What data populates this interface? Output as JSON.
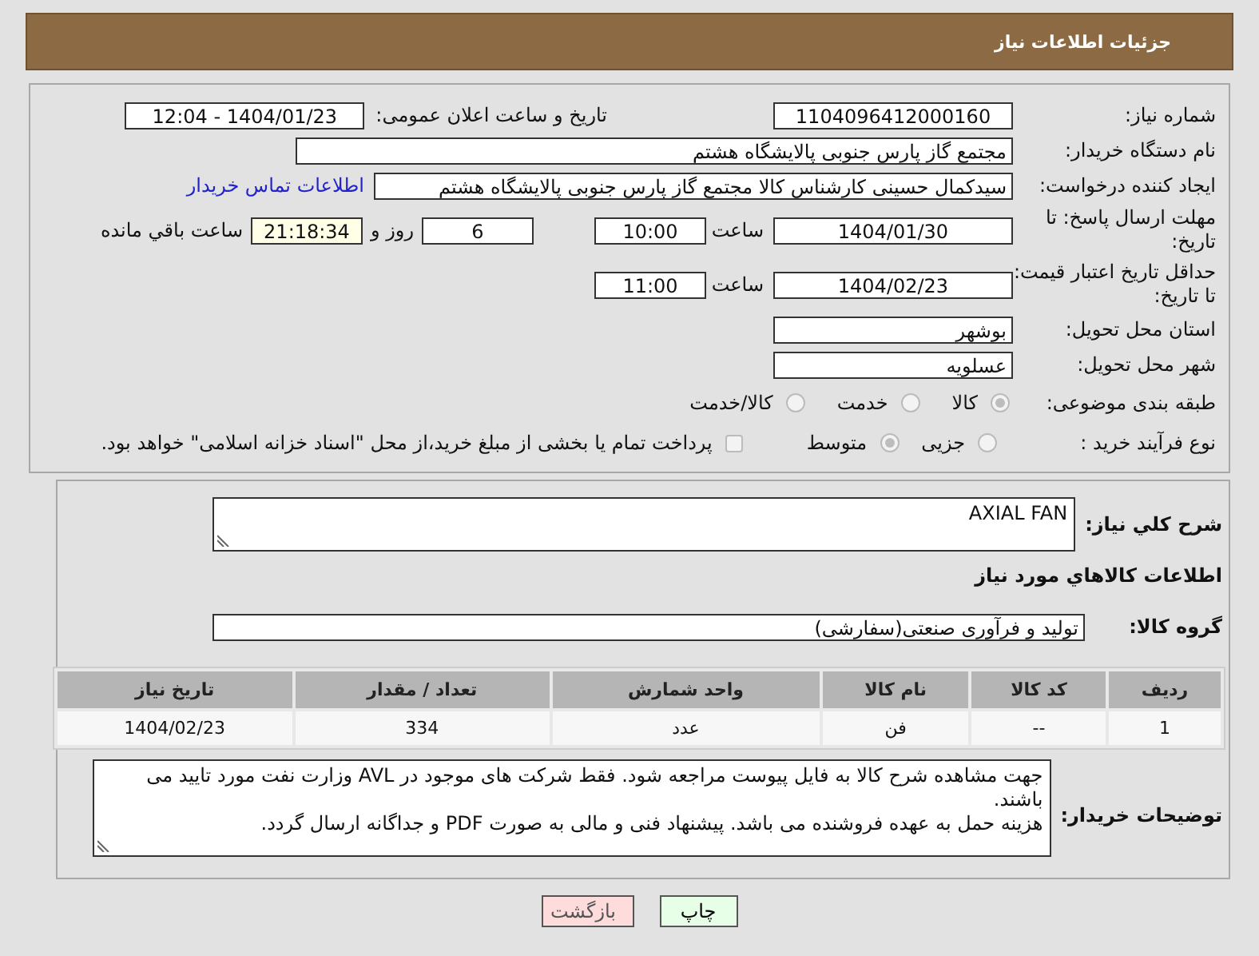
{
  "title": "جزئیات اطلاعات نیاز",
  "need_number": {
    "label": "شماره نیاز:",
    "value": "1104096412000160"
  },
  "announce": {
    "label": "تاریخ و ساعت اعلان عمومی:",
    "value": "1404/01/23 - 12:04"
  },
  "buyer": {
    "label": "نام دستگاه خریدار:",
    "value": "مجتمع گاز پارس جنوبی  پالایشگاه هشتم"
  },
  "creator": {
    "label": "ایجاد کننده درخواست:",
    "value": "سیدکمال حسینی کارشناس کالا مجتمع گاز پارس جنوبی  پالایشگاه هشتم",
    "link": "اطلاعات تماس خریدار"
  },
  "reply_deadline": {
    "label": "مهلت ارسال پاسخ: تا تاریخ:",
    "date": "1404/01/30",
    "time_label": "ساعت",
    "time": "10:00",
    "days": "6",
    "days_label": "روز و",
    "remaining": "21:18:34",
    "remaining_label": "ساعت باقي مانده"
  },
  "price_validity": {
    "label": "حداقل تاریخ اعتبار قیمت: تا تاریخ:",
    "date": "1404/02/23",
    "time_label": "ساعت",
    "time": "11:00"
  },
  "province": {
    "label": "استان محل تحویل:",
    "value": "بوشهر"
  },
  "city": {
    "label": "شهر محل تحویل:",
    "value": "عسلویه"
  },
  "category": {
    "label": "طبقه بندی موضوعی:",
    "options": [
      {
        "label": "کالا",
        "selected": true
      },
      {
        "label": "خدمت",
        "selected": false
      },
      {
        "label": "کالا/خدمت",
        "selected": false
      }
    ]
  },
  "process": {
    "label": "نوع فرآیند خرید :",
    "options": [
      {
        "label": "جزیی",
        "selected": false
      },
      {
        "label": "متوسط",
        "selected": true
      }
    ],
    "treasury": {
      "label": "پرداخت تمام یا بخشی از مبلغ خرید،از محل \"اسناد خزانه اسلامی\" خواهد بود.",
      "checked": false
    }
  },
  "description": {
    "label": "شرح کلي نیاز:",
    "value": "AXIAL FAN"
  },
  "goods_heading": "اطلاعات کالاهاي مورد نیاز",
  "goods_group": {
    "label": "گروه کالا:",
    "value": "تولید و فرآوری صنعتی(سفارشی)"
  },
  "table": {
    "columns": [
      "ردیف",
      "کد کالا",
      "نام کالا",
      "واحد شمارش",
      "تعداد / مقدار",
      "تاریخ نیاز"
    ],
    "rows": [
      [
        "1",
        "--",
        "فن",
        "عدد",
        "334",
        "1404/02/23"
      ]
    ]
  },
  "notes": {
    "label": "توضیحات خریدار:",
    "value": "جهت مشاهده شرح کالا به فایل پیوست مراجعه شود. فقط شرکت های موجود در AVL وزارت نفت مورد تایید می باشند.\nهزینه حمل به عهده فروشنده می باشد. پیشنهاد فنی و مالی به صورت PDF و جداگانه ارسال گردد."
  },
  "buttons": [
    {
      "label": "چاپ",
      "kind": "print"
    },
    {
      "label": "بازگشت",
      "kind": "back"
    }
  ]
}
